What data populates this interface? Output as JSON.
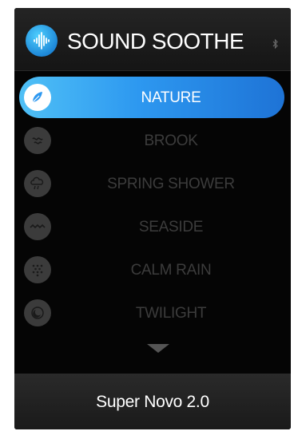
{
  "header": {
    "title": "SOUND SOOTHE",
    "logo_icon": "soundwave-icon",
    "status_icon": "bluetooth-icon"
  },
  "sounds": [
    {
      "label": "NATURE",
      "icon": "leaf-icon",
      "active": true
    },
    {
      "label": "BROOK",
      "icon": "brook-icon",
      "active": false
    },
    {
      "label": "SPRING SHOWER",
      "icon": "shower-icon",
      "active": false
    },
    {
      "label": "SEASIDE",
      "icon": "waves-icon",
      "active": false
    },
    {
      "label": "CALM RAIN",
      "icon": "rain-drops-icon",
      "active": false
    },
    {
      "label": "TWILIGHT",
      "icon": "moon-icon",
      "active": false
    }
  ],
  "scroll_icon": "chevron-down-icon",
  "footer": {
    "device_name": "Super Novo 2.0"
  },
  "colors": {
    "accent_start": "#4fc0f6",
    "accent_end": "#1e73d6",
    "background": "#050505",
    "inactive_text": "#3c3c3c"
  }
}
